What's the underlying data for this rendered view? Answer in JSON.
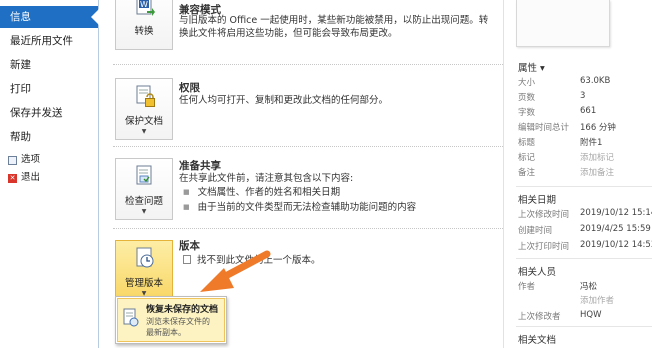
{
  "sidebar": {
    "items": [
      {
        "label": "信息"
      },
      {
        "label": "最近所用文件"
      },
      {
        "label": "新建"
      },
      {
        "label": "打印"
      },
      {
        "label": "保存并发送"
      },
      {
        "label": "帮助"
      }
    ],
    "options_label": "选项",
    "exit_label": "退出"
  },
  "compat": {
    "button_label": "转换",
    "title": "兼容模式",
    "desc": "与旧版本的 Office 一起使用时，某些新功能被禁用，以防止出现问题。转换此文件将启用这些功能，但可能会导致布局更改。"
  },
  "permissions": {
    "button_label": "保护文档",
    "title": "权限",
    "desc": "任何人均可打开、复制和更改此文档的任何部分。"
  },
  "share": {
    "button_label": "检查问题",
    "title": "准备共享",
    "desc": "在共享此文件前，请注意其包含以下内容:",
    "bullets": [
      "文档属性、作者的姓名和相关日期",
      "由于当前的文件类型而无法检查辅助功能问题的内容"
    ]
  },
  "versions": {
    "button_label": "管理版本",
    "title": "版本",
    "desc": "找不到此文件的上一个版本。"
  },
  "popup": {
    "title": "恢复未保存的文档",
    "desc_line1": "浏览未保存文件的",
    "desc_line2": "最新副本。"
  },
  "properties": {
    "header": "属性 ▾",
    "rows": [
      {
        "key": "大小",
        "value": "63.0KB"
      },
      {
        "key": "页数",
        "value": "3"
      },
      {
        "key": "字数",
        "value": "661"
      },
      {
        "key": "编辑时间总计",
        "value": "166 分钟"
      },
      {
        "key": "标题",
        "value": "附件1"
      },
      {
        "key": "标记",
        "value": "添加标记"
      },
      {
        "key": "备注",
        "value": "添加备注"
      }
    ]
  },
  "dates": {
    "header": "相关日期",
    "rows": [
      {
        "key": "上次修改时间",
        "value": "2019/10/12 15:14"
      },
      {
        "key": "创建时间",
        "value": "2019/4/25 15:59"
      },
      {
        "key": "上次打印时间",
        "value": "2019/10/12 14:53"
      }
    ]
  },
  "people": {
    "header": "相关人员",
    "author_key": "作者",
    "author": "冯松",
    "add_author": "添加作者",
    "modified_by_key": "上次修改者",
    "modified_by": "HQW"
  },
  "docs": {
    "header": "相关文档"
  },
  "colors": {
    "nav_active": "#1f6fc5",
    "highlight": "#f9d664",
    "arrow": "#ee7a2a"
  },
  "icons": [
    "convert-icon",
    "protect-document-icon",
    "inspect-icon",
    "manage-versions-icon",
    "recover-document-icon",
    "options-icon",
    "exit-icon"
  ]
}
